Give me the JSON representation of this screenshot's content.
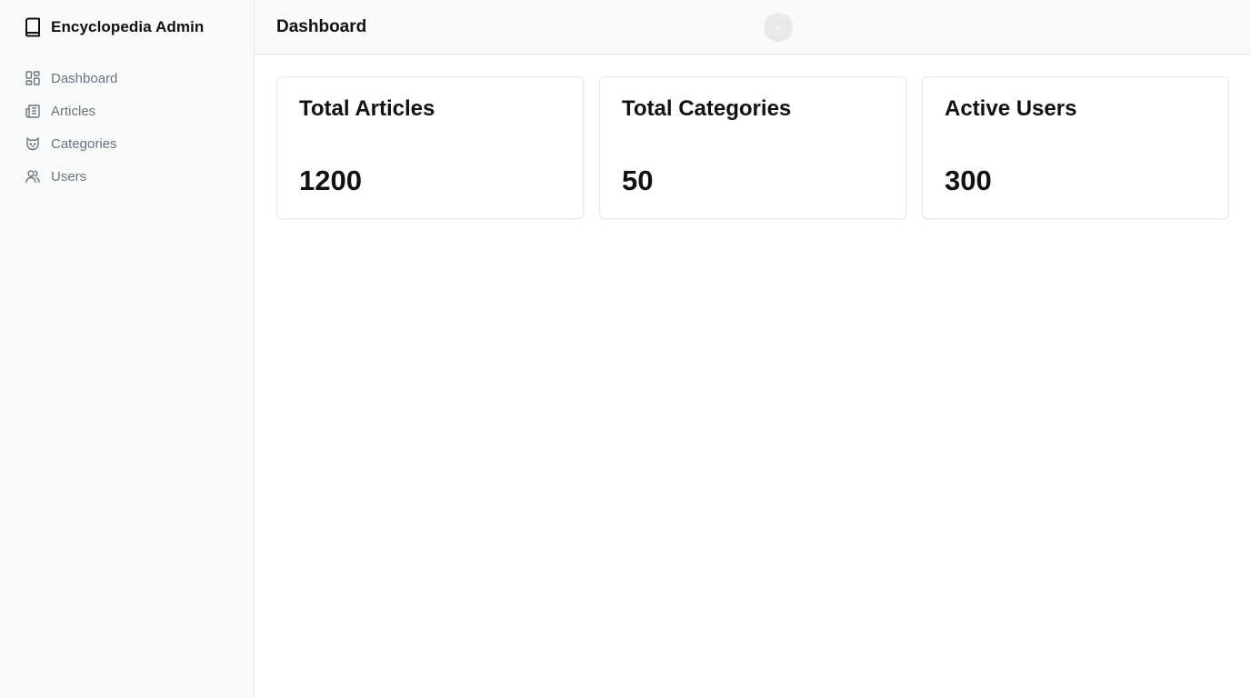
{
  "app": {
    "title": "Encyclopedia Admin",
    "brand_icon": "book-icon"
  },
  "sidebar": {
    "items": [
      {
        "label": "Dashboard",
        "icon": "dashboard-grid-icon"
      },
      {
        "label": "Articles",
        "icon": "newspaper-icon"
      },
      {
        "label": "Categories",
        "icon": "cat-icon"
      },
      {
        "label": "Users",
        "icon": "users-icon"
      }
    ]
  },
  "header": {
    "title": "Dashboard"
  },
  "stats": [
    {
      "title": "Total Articles",
      "value": "1200"
    },
    {
      "title": "Total Categories",
      "value": "50"
    },
    {
      "title": "Active Users",
      "value": "300"
    }
  ],
  "colors": {
    "sidebar_bg": "#f9fafa",
    "border": "#e5e7eb",
    "muted_text": "#6b7280",
    "text": "#111111"
  }
}
